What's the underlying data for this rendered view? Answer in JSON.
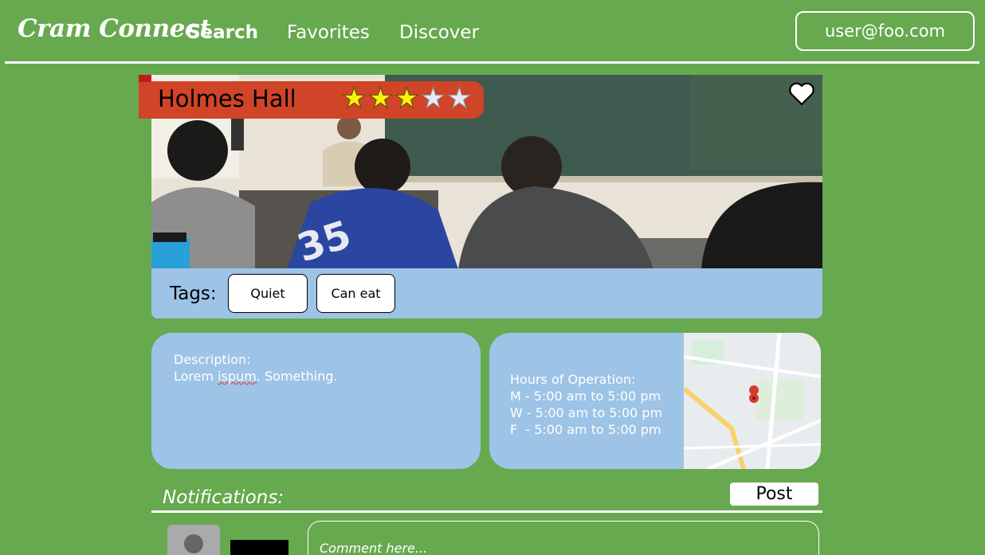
{
  "nav": {
    "logo": "Cram Connect",
    "links": [
      "Search",
      "Favorites",
      "Discover"
    ],
    "user": "user@foo.com"
  },
  "place": {
    "name": "Holmes Hall",
    "rating": 3,
    "max_rating": 5,
    "tags_label": "Tags:",
    "tags": [
      "Quiet",
      "Can eat"
    ]
  },
  "description": {
    "heading": "Description:",
    "text_word1": "Lorem",
    "text_word2": "ispum",
    "text_rest": ". Something."
  },
  "hours": {
    "heading": "Hours of Operation:",
    "lines": [
      "M - 5:00 am to 5:00 pm",
      "W - 5:00 am to 5:00 pm",
      "F  - 5:00 am to 5:00 pm"
    ]
  },
  "notifications": {
    "title": "Notifications:",
    "post_label": "Post",
    "comment_placeholder": "Comment here..."
  },
  "colors": {
    "background": "#67a94e",
    "card": "#9dc3e7",
    "banner": "#d04427",
    "star_on": "#f9f20f"
  }
}
